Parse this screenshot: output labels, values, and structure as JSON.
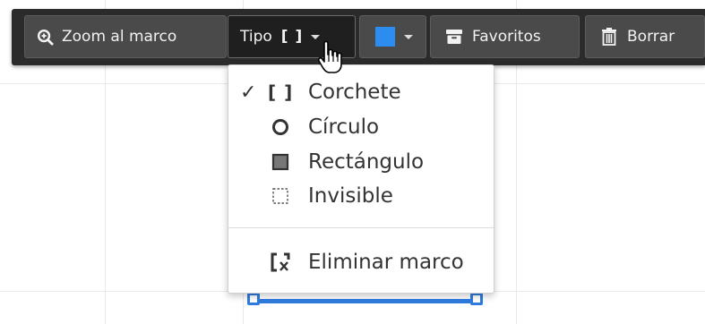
{
  "toolbar": {
    "zoom_label": "Zoom al marco",
    "tipo_label": "Tipo",
    "tipo_icon_text": "[ ]",
    "favoritos_label": "Favoritos",
    "borrar_label": "Borrar",
    "color_swatch": "#2d8cf0",
    "bg_color": "#2b2b2b",
    "button_color": "#4a4a4a"
  },
  "menu": {
    "items": [
      {
        "label": "Corchete",
        "checked": true,
        "check_mark": "✓",
        "icon": "bracket-icon",
        "icon_text": "[ ]"
      },
      {
        "label": "Círculo",
        "checked": false,
        "icon": "circle-icon"
      },
      {
        "label": "Rectángulo",
        "checked": false,
        "icon": "filled-square-icon"
      },
      {
        "label": "Invisible",
        "checked": false,
        "icon": "dashed-square-icon"
      }
    ],
    "remove": {
      "label": "Eliminar marco",
      "icon": "remove-frame-icon"
    }
  },
  "frame": {
    "color": "#2f7bde"
  }
}
